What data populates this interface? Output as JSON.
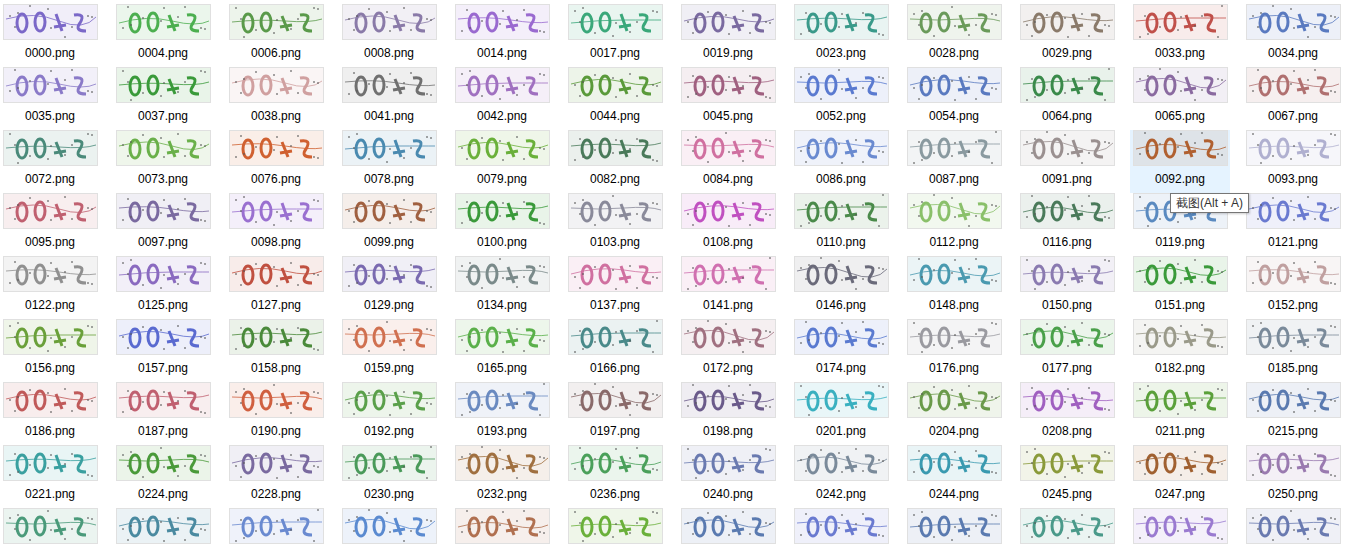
{
  "files": [
    {
      "label": "0000.png",
      "color": "#7b68c8",
      "selected": false
    },
    {
      "label": "0004.png",
      "color": "#4caf50",
      "selected": false
    },
    {
      "label": "0006.png",
      "color": "#5a9a4a",
      "selected": false
    },
    {
      "label": "0008.png",
      "color": "#8a7aa8",
      "selected": false
    },
    {
      "label": "0014.png",
      "color": "#9a6ad0",
      "selected": false
    },
    {
      "label": "0017.png",
      "color": "#3aa87a",
      "selected": false
    },
    {
      "label": "0019.png",
      "color": "#7a6aa0",
      "selected": false
    },
    {
      "label": "0023.png",
      "color": "#3a9a8a",
      "selected": false
    },
    {
      "label": "0028.png",
      "color": "#6a9a5a",
      "selected": false
    },
    {
      "label": "0029.png",
      "color": "#8a7a6a",
      "selected": false
    },
    {
      "label": "0033.png",
      "color": "#c0504a",
      "selected": false
    },
    {
      "label": "0034.png",
      "color": "#5a7ac0",
      "selected": false
    },
    {
      "label": "0035.png",
      "color": "#8a7ac8",
      "selected": false
    },
    {
      "label": "0037.png",
      "color": "#3a9a3a",
      "selected": false
    },
    {
      "label": "0038.png",
      "color": "#d0a0a0",
      "selected": false
    },
    {
      "label": "0041.png",
      "color": "#707070",
      "selected": false
    },
    {
      "label": "0042.png",
      "color": "#a070c0",
      "selected": false
    },
    {
      "label": "0044.png",
      "color": "#5a9a3a",
      "selected": false
    },
    {
      "label": "0045.png",
      "color": "#a06080",
      "selected": false
    },
    {
      "label": "0052.png",
      "color": "#5a7ad0",
      "selected": false
    },
    {
      "label": "0054.png",
      "color": "#5a7ac0",
      "selected": false
    },
    {
      "label": "0064.png",
      "color": "#3a8a4a",
      "selected": false
    },
    {
      "label": "0065.png",
      "color": "#8a6aa0",
      "selected": false
    },
    {
      "label": "0067.png",
      "color": "#b07070",
      "selected": false
    },
    {
      "label": "0072.png",
      "color": "#4a8a7a",
      "selected": false
    },
    {
      "label": "0073.png",
      "color": "#6ab04a",
      "selected": false
    },
    {
      "label": "0076.png",
      "color": "#d06030",
      "selected": false
    },
    {
      "label": "0078.png",
      "color": "#4a8ab0",
      "selected": false
    },
    {
      "label": "0079.png",
      "color": "#6ab03a",
      "selected": false
    },
    {
      "label": "0082.png",
      "color": "#4a7a5a",
      "selected": false
    },
    {
      "label": "0084.png",
      "color": "#d070a0",
      "selected": false
    },
    {
      "label": "0086.png",
      "color": "#6a8ad0",
      "selected": false
    },
    {
      "label": "0087.png",
      "color": "#8a9aa0",
      "selected": false
    },
    {
      "label": "0091.png",
      "color": "#9a9090",
      "selected": false
    },
    {
      "label": "0092.png",
      "color": "#b06030",
      "selected": true
    },
    {
      "label": "0093.png",
      "color": "#b0b0d0",
      "selected": false
    },
    {
      "label": "0095.png",
      "color": "#c06070",
      "selected": false
    },
    {
      "label": "0097.png",
      "color": "#7a6aa0",
      "selected": false
    },
    {
      "label": "0098.png",
      "color": "#9a70d0",
      "selected": false
    },
    {
      "label": "0099.png",
      "color": "#a06040",
      "selected": false
    },
    {
      "label": "0100.png",
      "color": "#3a9a3a",
      "selected": false
    },
    {
      "label": "0103.png",
      "color": "#8a8a9a",
      "selected": false
    },
    {
      "label": "0108.png",
      "color": "#c050c0",
      "selected": false
    },
    {
      "label": "0110.png",
      "color": "#4a8a4a",
      "selected": false
    },
    {
      "label": "0112.png",
      "color": "#8ac06a",
      "selected": false
    },
    {
      "label": "0116.png",
      "color": "#4a7a5a",
      "selected": false
    },
    {
      "label": "0119.png",
      "color": "#5a8ac0",
      "selected": false
    },
    {
      "label": "0121.png",
      "color": "#6a7ad0",
      "selected": false
    },
    {
      "label": "0122.png",
      "color": "#909090",
      "selected": false
    },
    {
      "label": "0125.png",
      "color": "#8a6ac0",
      "selected": false
    },
    {
      "label": "0127.png",
      "color": "#c05040",
      "selected": false
    },
    {
      "label": "0129.png",
      "color": "#7a6ab0",
      "selected": false
    },
    {
      "label": "0134.png",
      "color": "#7a8a8a",
      "selected": false
    },
    {
      "label": "0137.png",
      "color": "#d070a0",
      "selected": false
    },
    {
      "label": "0141.png",
      "color": "#d070b0",
      "selected": false
    },
    {
      "label": "0146.png",
      "color": "#6a6a7a",
      "selected": false
    },
    {
      "label": "0148.png",
      "color": "#4a9ab0",
      "selected": false
    },
    {
      "label": "0150.png",
      "color": "#8a7ab0",
      "selected": false
    },
    {
      "label": "0151.png",
      "color": "#3a9a3a",
      "selected": false
    },
    {
      "label": "0152.png",
      "color": "#c0a0a0",
      "selected": false
    },
    {
      "label": "0156.png",
      "color": "#6aa03a",
      "selected": false
    },
    {
      "label": "0157.png",
      "color": "#5a6ad0",
      "selected": false
    },
    {
      "label": "0158.png",
      "color": "#4a8a3a",
      "selected": false
    },
    {
      "label": "0159.png",
      "color": "#d07050",
      "selected": false
    },
    {
      "label": "0165.png",
      "color": "#5ab04a",
      "selected": false
    },
    {
      "label": "0166.png",
      "color": "#4a8a8a",
      "selected": false
    },
    {
      "label": "0172.png",
      "color": "#a07080",
      "selected": false
    },
    {
      "label": "0174.png",
      "color": "#5a7ad0",
      "selected": false
    },
    {
      "label": "0176.png",
      "color": "#9a9aa0",
      "selected": false
    },
    {
      "label": "0177.png",
      "color": "#4aa04a",
      "selected": false
    },
    {
      "label": "0182.png",
      "color": "#9a9a8a",
      "selected": false
    },
    {
      "label": "0185.png",
      "color": "#7a8a9a",
      "selected": false
    },
    {
      "label": "0186.png",
      "color": "#c05a5a",
      "selected": false
    },
    {
      "label": "0187.png",
      "color": "#c06070",
      "selected": false
    },
    {
      "label": "0190.png",
      "color": "#d06040",
      "selected": false
    },
    {
      "label": "0192.png",
      "color": "#5aa04a",
      "selected": false
    },
    {
      "label": "0193.png",
      "color": "#6a8ac0",
      "selected": false
    },
    {
      "label": "0197.png",
      "color": "#8a6a6a",
      "selected": false
    },
    {
      "label": "0198.png",
      "color": "#6a5a8a",
      "selected": false
    },
    {
      "label": "0201.png",
      "color": "#3ab0c0",
      "selected": false
    },
    {
      "label": "0204.png",
      "color": "#6a9a4a",
      "selected": false
    },
    {
      "label": "0208.png",
      "color": "#a060c0",
      "selected": false
    },
    {
      "label": "0211.png",
      "color": "#5aa03a",
      "selected": false
    },
    {
      "label": "0215.png",
      "color": "#5a7ab0",
      "selected": false
    },
    {
      "label": "0221.png",
      "color": "#3aa0a0",
      "selected": false
    },
    {
      "label": "0224.png",
      "color": "#4a9a3a",
      "selected": false
    },
    {
      "label": "0228.png",
      "color": "#7a6aa0",
      "selected": false
    },
    {
      "label": "0230.png",
      "color": "#4a9a5a",
      "selected": false
    },
    {
      "label": "0232.png",
      "color": "#a07040",
      "selected": false
    },
    {
      "label": "0236.png",
      "color": "#4aa05a",
      "selected": false
    },
    {
      "label": "0240.png",
      "color": "#6a7ab0",
      "selected": false
    },
    {
      "label": "0242.png",
      "color": "#7a8a9a",
      "selected": false
    },
    {
      "label": "0244.png",
      "color": "#3a9ab0",
      "selected": false
    },
    {
      "label": "0245.png",
      "color": "#8a9a3a",
      "selected": false
    },
    {
      "label": "0247.png",
      "color": "#a06030",
      "selected": false
    },
    {
      "label": "0250.png",
      "color": "#9a7ab0",
      "selected": false
    },
    {
      "color": "#4a9a7a",
      "selected": false
    },
    {
      "color": "#4a8aa0",
      "selected": false
    },
    {
      "color": "#6a8ad0",
      "selected": false
    },
    {
      "color": "#5a8ad0",
      "selected": false
    },
    {
      "color": "#b07050",
      "selected": false
    },
    {
      "color": "#6ab03a",
      "selected": false
    },
    {
      "color": "#5a7ab0",
      "selected": false
    },
    {
      "color": "#6a7ad0",
      "selected": false
    },
    {
      "color": "#5a7ab0",
      "selected": false
    },
    {
      "color": "#4a9a8a",
      "selected": false
    },
    {
      "color": "#9a7ad0",
      "selected": false
    },
    {
      "color": "#6a7ab0",
      "selected": false
    }
  ],
  "tooltip": {
    "text": "截图(Alt + A)"
  }
}
